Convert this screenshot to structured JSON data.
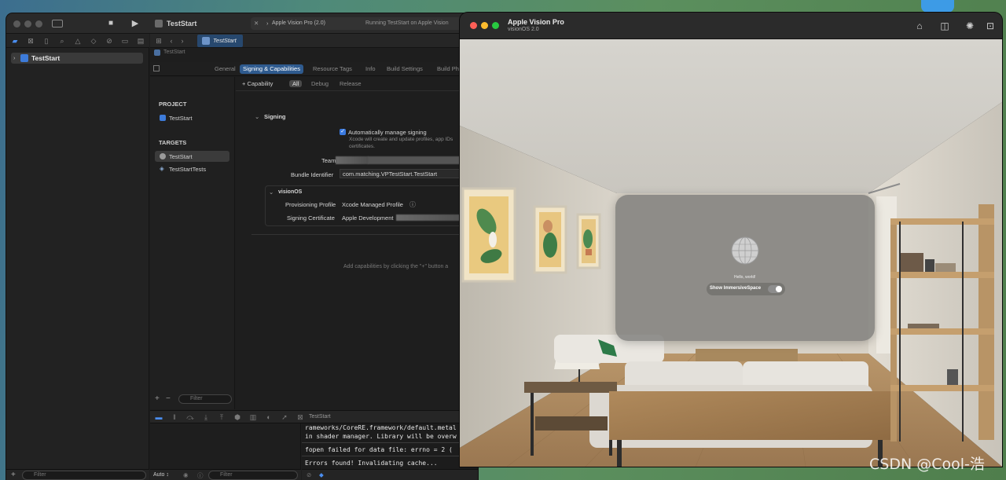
{
  "xcode": {
    "toolbar": {
      "app_name": "TestStart",
      "scheme_device": "Apple Vision Pro (2.0)",
      "status": "Running TestStart on Apple Vision"
    },
    "navigator": {
      "project_name": "TestStart",
      "filter_placeholder": "Filter"
    },
    "tab": {
      "name": "TestStart"
    },
    "breadcrumb": "TestStart",
    "editor_tabs": [
      "General",
      "Signing & Capabilities",
      "Resource Tags",
      "Info",
      "Build Settings",
      "Build Ph"
    ],
    "project_list": {
      "project_header": "PROJECT",
      "project_item": "TestStart",
      "targets_header": "TARGETS",
      "targets": [
        "TestStart",
        "TestStartTests"
      ],
      "filter_placeholder": "Filter"
    },
    "capability_bar": {
      "add_label": "+ Capability",
      "tabs": [
        "All",
        "Debug",
        "Release"
      ]
    },
    "signing": {
      "section_title": "Signing",
      "auto_manage_label": "Automatically manage signing",
      "auto_manage_desc_1": "Xcode will create and update profiles, app IDs",
      "auto_manage_desc_2": "certificates.",
      "team_label": "Team",
      "bundle_id_label": "Bundle Identifier",
      "bundle_id_value": "com.matching.VPTestStart.TestStart",
      "platform": "visionOS",
      "provisioning_label": "Provisioning Profile",
      "provisioning_value": "Xcode Managed Profile",
      "cert_label": "Signing Certificate",
      "cert_value": "Apple Development",
      "cert_suffix": "o"
    },
    "hint": "Add capabilities by clicking the \"+\" button a",
    "debug_bar": {
      "target": "TestStart"
    },
    "console": [
      "rameworks/CoreRE.framework/default.metal",
      "in shader manager. Library will be overw",
      "fopen failed for data file: errno = 2 (",
      "Errors found! Invalidating cache..."
    ],
    "bottom": {
      "mode": "Auto ↕",
      "filter_placeholder": "Filter"
    }
  },
  "simulator": {
    "title": "Apple Vision Pro",
    "subtitle": "visionOS 2.0",
    "app_window": {
      "hello": "Hello, world!",
      "toggle_label": "Show ImmersiveSpace",
      "toggle_on": false
    }
  },
  "watermark": "CSDN @Cool-浩",
  "icons": {
    "play": "play-icon",
    "stop": "stop-icon",
    "home": "home-icon",
    "screenshot": "camera-icon",
    "rotate": "rotate-icon",
    "move": "move-icon"
  },
  "colors": {
    "accent": "#3d7bd9",
    "selected_tab": "#2f5b8f",
    "sim_chrome": "#2b2b2b"
  }
}
